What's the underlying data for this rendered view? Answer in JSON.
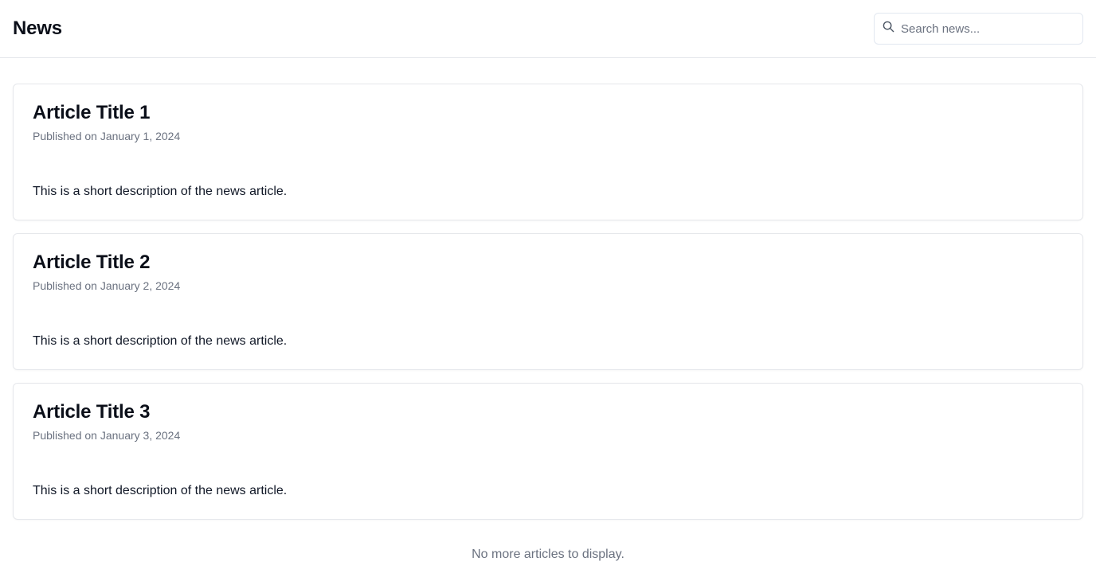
{
  "header": {
    "title": "News",
    "search": {
      "placeholder": "Search news...",
      "value": "",
      "icon": "search-icon"
    }
  },
  "articles": [
    {
      "title": "Article Title 1",
      "date": "Published on January 1, 2024",
      "description": "This is a short description of the news article."
    },
    {
      "title": "Article Title 2",
      "date": "Published on January 2, 2024",
      "description": "This is a short description of the news article."
    },
    {
      "title": "Article Title 3",
      "date": "Published on January 3, 2024",
      "description": "This is a short description of the news article."
    }
  ],
  "footer": {
    "end_message": "No more articles to display."
  }
}
